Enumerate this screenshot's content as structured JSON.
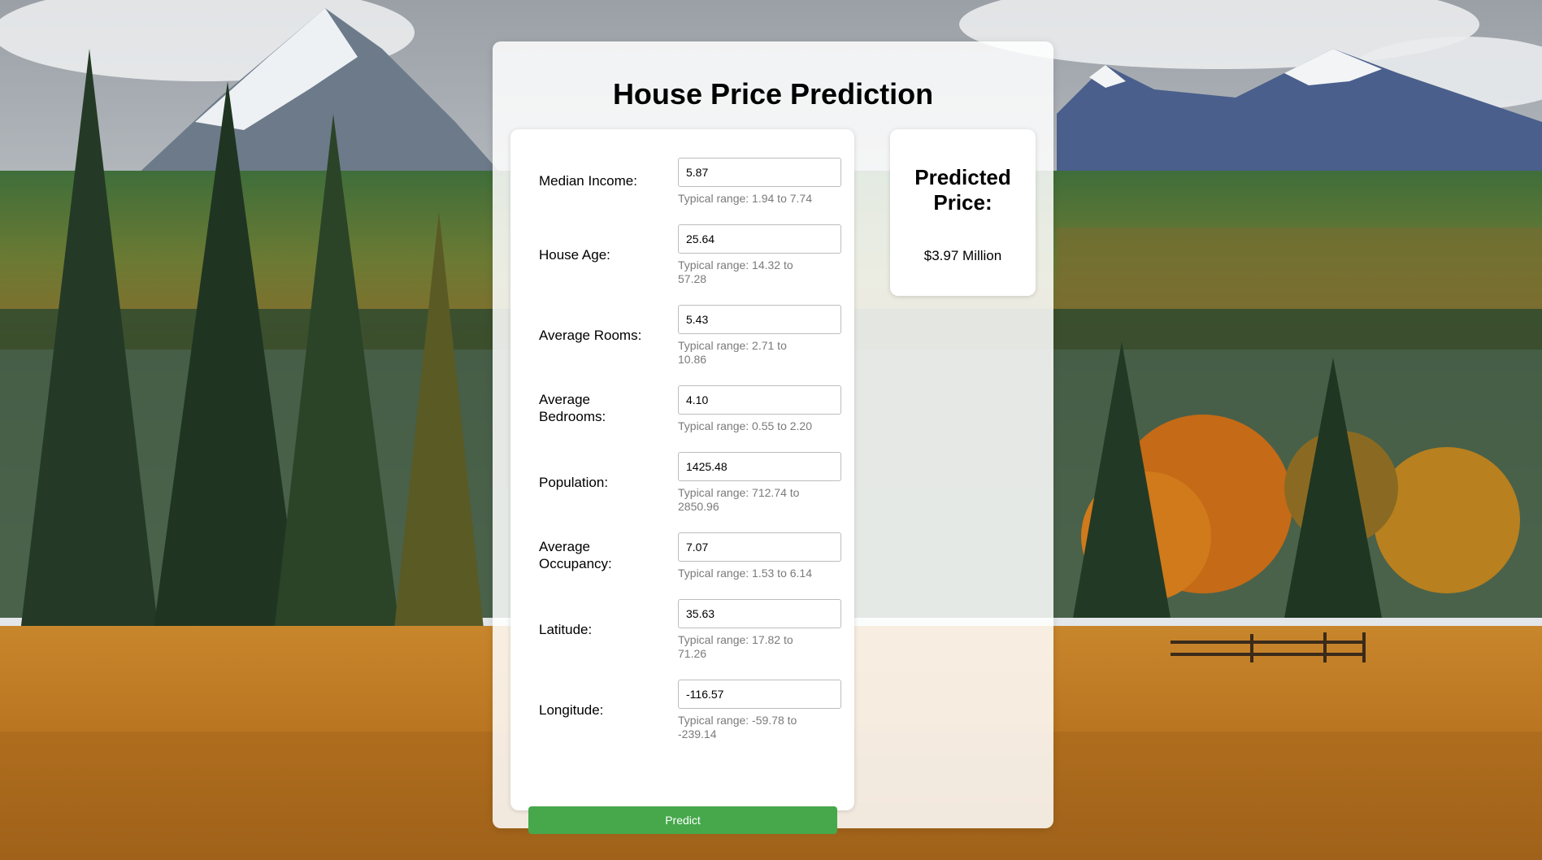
{
  "page": {
    "title": "House Price Prediction"
  },
  "form": {
    "fields": [
      {
        "label": "Median Income:",
        "value": "5.87",
        "hint": "Typical range: 1.94 to 7.74"
      },
      {
        "label": "House Age:",
        "value": "25.64",
        "hint": "Typical range: 14.32 to 57.28"
      },
      {
        "label": "Average Rooms:",
        "value": "5.43",
        "hint": "Typical range: 2.71 to 10.86"
      },
      {
        "label": "Average Bedrooms:",
        "value": "4.10",
        "hint": "Typical range: 0.55 to 2.20"
      },
      {
        "label": "Population:",
        "value": "1425.48",
        "hint": "Typical range: 712.74 to 2850.96"
      },
      {
        "label": "Average Occupancy:",
        "value": "7.07",
        "hint": "Typical range: 1.53 to 6.14"
      },
      {
        "label": "Latitude:",
        "value": "35.63",
        "hint": "Typical range: 17.82 to 71.26"
      },
      {
        "label": "Longitude:",
        "value": "-116.57",
        "hint": "Typical range: -59.78 to -239.14"
      }
    ],
    "submit_label": "Predict"
  },
  "result": {
    "title": "Predicted Price:",
    "value": "$3.97 Million"
  },
  "colors": {
    "predict_button": "#46a84b",
    "hint_text": "#7a7a7a"
  }
}
